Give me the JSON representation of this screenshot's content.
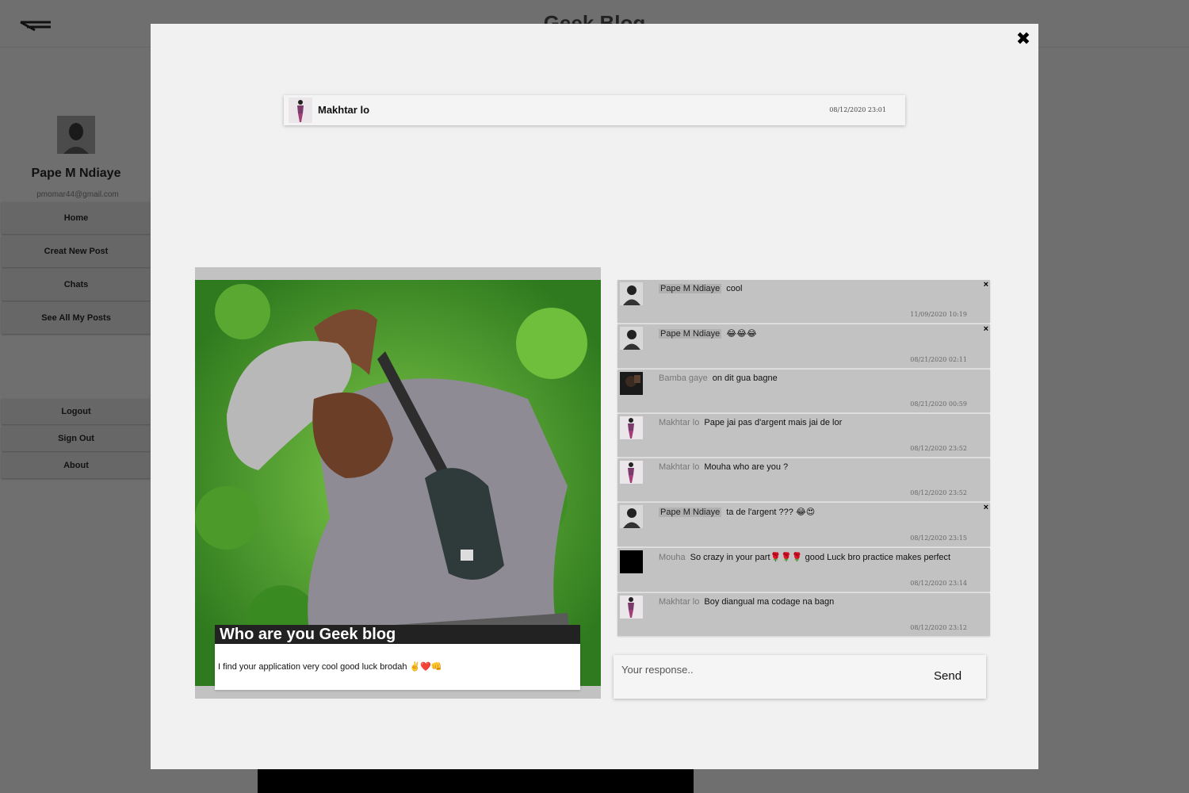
{
  "app": {
    "title": "Geek Blog"
  },
  "sidebar": {
    "profile": {
      "name": "Pape M Ndiaye",
      "email": "pmomar44@gmail.com"
    },
    "items": [
      {
        "label": "Home"
      },
      {
        "label": "Creat New Post"
      },
      {
        "label": "Chats"
      },
      {
        "label": "See All My Posts"
      }
    ],
    "bottom_items": [
      {
        "label": "Logout"
      },
      {
        "label": "Sign Out"
      },
      {
        "label": "About"
      }
    ]
  },
  "modal": {
    "close_icon": "close-icon",
    "author": {
      "name": "Makhtar lo",
      "date": "08/12/2020 23:01"
    },
    "post": {
      "title": "Who are you Geek blog",
      "text": "I find your application very cool good luck brodah ✌️❤️👊"
    },
    "comments": [
      {
        "name": "Pape M Ndiaye",
        "text": "cool",
        "date": "11/09/2020 10:19"
      },
      {
        "name": "Pape M Ndiaye",
        "text": "😂😂😂",
        "date": "08/21/2020 02:11"
      },
      {
        "name": "Bamba gaye",
        "text": "on dit gua bagne",
        "date": "08/21/2020 00:59"
      },
      {
        "name": "Makhtar lo",
        "text": "Pape jai pas d'argent mais jai de lor",
        "date": "08/12/2020 23:52"
      },
      {
        "name": "Makhtar lo",
        "text": "Mouha who are you ?",
        "date": "08/12/2020 23:52"
      },
      {
        "name": "Pape M Ndiaye",
        "text": "ta de l'argent ??? 😂😍",
        "date": "08/12/2020 23:15"
      },
      {
        "name": "Mouha",
        "text": "So crazy in your part🌹🌹🌹 good Luck bro practice makes perfect",
        "date": "08/12/2020 23:14"
      },
      {
        "name": "Makhtar lo",
        "text": "Boy diangual ma codage na bagn",
        "date": "08/12/2020 23:12"
      }
    ],
    "delete_label": "×",
    "reply": {
      "placeholder": "Your response..",
      "send_label": "Send"
    }
  }
}
